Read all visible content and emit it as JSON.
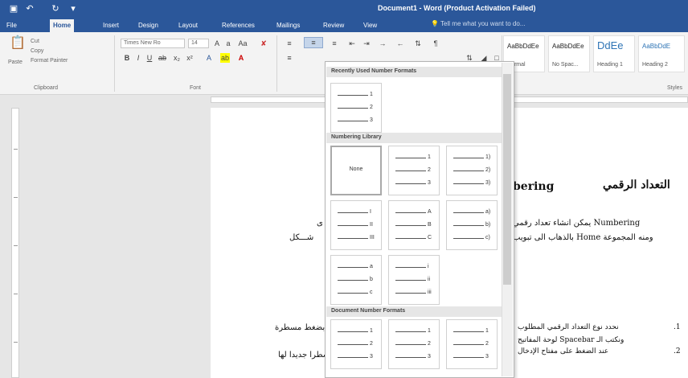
{
  "title_bar": {
    "title": "Document1 - Word (Product Activation Failed)",
    "quick_access": [
      "save-icon",
      "undo-icon",
      "redo-icon",
      "customize-icon"
    ]
  },
  "tabs": [
    {
      "label": "File"
    },
    {
      "label": "Home",
      "active": true
    },
    {
      "label": "Insert"
    },
    {
      "label": "Design"
    },
    {
      "label": "Layout"
    },
    {
      "label": "References"
    },
    {
      "label": "Mailings"
    },
    {
      "label": "Review"
    },
    {
      "label": "View"
    }
  ],
  "tell_me": "Tell me what you want to do...",
  "ribbon": {
    "clipboard": {
      "paste": "Paste",
      "cut": "Cut",
      "copy": "Copy",
      "format_painter": "Format Painter",
      "label": "Clipboard"
    },
    "font": {
      "name": "Times New Ro",
      "size": "14",
      "label": "Font"
    },
    "styles": {
      "label": "Styles",
      "items": [
        {
          "preview": "AaBbDdEe",
          "name": "Normal"
        },
        {
          "preview": "AaBbDdEe",
          "name": "No Spac..."
        },
        {
          "preview": "DdEe",
          "name": "Heading 1"
        },
        {
          "preview": "AaBbDdE",
          "name": "Heading 2"
        }
      ]
    }
  },
  "numbering_dropdown": {
    "recently_used_header": "Recently Used Number Formats",
    "library_header": "Numbering Library",
    "document_header": "Document Number Formats",
    "none_label": "None",
    "recent": [
      [
        "1",
        "2",
        "3"
      ]
    ],
    "library": [
      [
        "1",
        "2",
        "3"
      ],
      [
        "1)",
        "2)",
        "3)"
      ],
      [
        "I",
        "II",
        "III"
      ],
      [
        "A",
        "B",
        "C"
      ],
      [
        "a)",
        "b)",
        "c)"
      ],
      [
        "a",
        "b",
        "c"
      ],
      [
        "i",
        "ii",
        "iii"
      ]
    ],
    "document": [
      [
        "1",
        "2",
        "3"
      ],
      [
        "1",
        "2",
        "3"
      ],
      [
        "1",
        "2",
        "3"
      ]
    ]
  },
  "document": {
    "heading_left": "bering",
    "heading_right": "التعداد الرقمي",
    "line1": "يمكن انشاء تعداد رقمي Numbering",
    "line2": "بالذهاب الى تبويب Home ومنه المجموعة",
    "frag_left1": "ى",
    "frag_left2": "شـــكل",
    "bottom_left1": "بضغط مسطرة",
    "bottom_right1": "نحدد نوع التعداد الرقمي المطلوب",
    "bottom_right2": "لوحة المفاتيح Spacebar ونكتب الـ",
    "bottom_left2": "سطرا جديدا لها",
    "bottom_right3": "عند الضغط على مفتاح الإدخال"
  }
}
